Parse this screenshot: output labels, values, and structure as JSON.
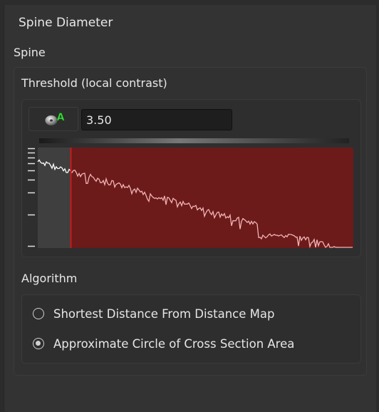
{
  "panel": {
    "title": "Spine Diameter",
    "section_label": "Spine"
  },
  "threshold": {
    "label": "Threshold (local contrast)",
    "auto_icon": "auto-threshold-icon",
    "auto_badge": "A",
    "value": "3.50"
  },
  "histogram": {
    "threshold_fraction": 0.105,
    "colors": {
      "left_bg": "#3f3f3f",
      "selected_bg": "#6c1a1a",
      "threshold_line": "#c41c1c",
      "curve_left": "#ffffff",
      "curve_right": "#f0b4b4"
    }
  },
  "algorithm": {
    "label": "Algorithm",
    "options": [
      {
        "label": "Shortest Distance From Distance Map",
        "selected": false
      },
      {
        "label": "Approximate Circle of Cross Section Area",
        "selected": true
      }
    ]
  }
}
